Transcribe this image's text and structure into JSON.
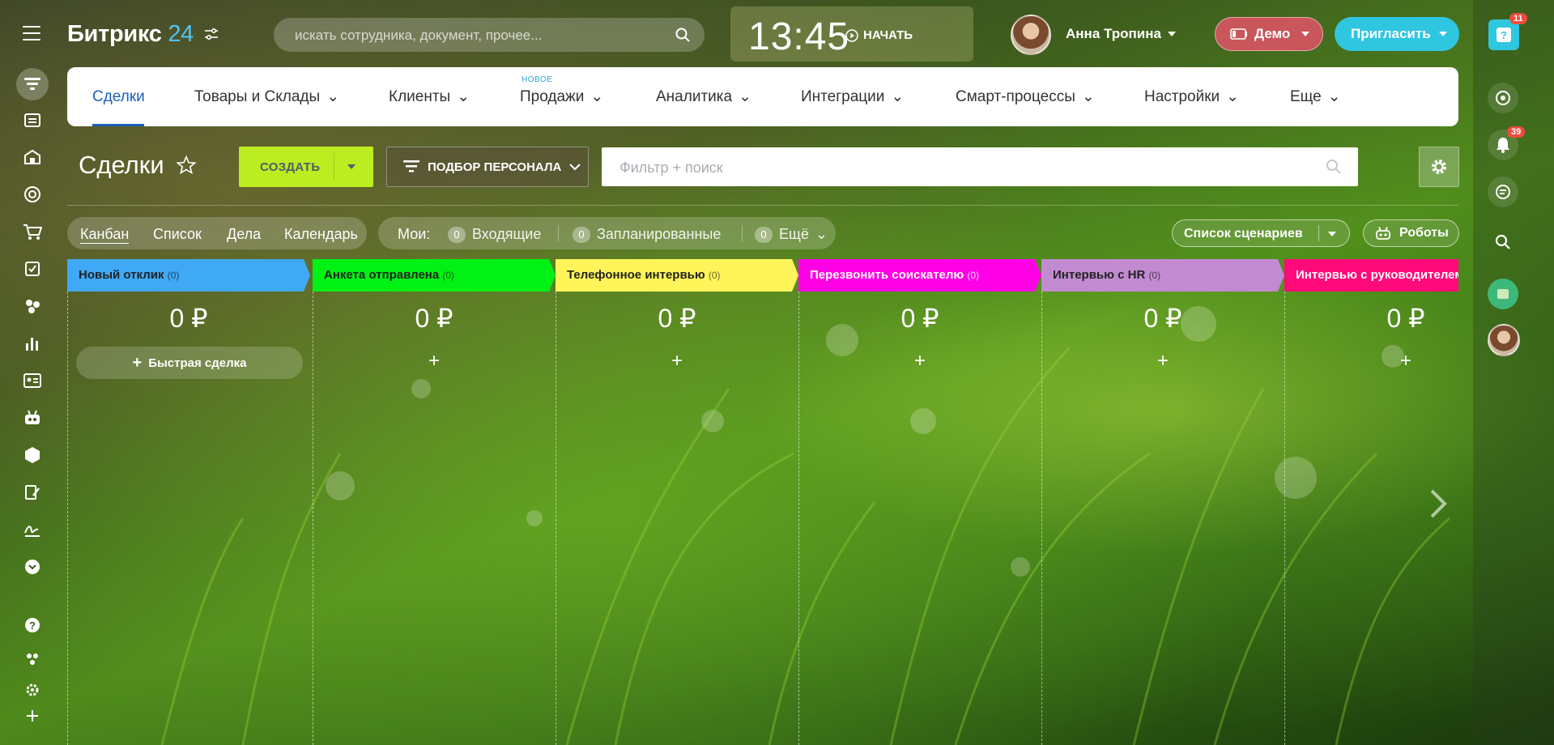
{
  "app": {
    "logo": {
      "name": "Битрикс",
      "num": "24"
    },
    "search_placeholder": "искать сотрудника, документ, прочее...",
    "clock": {
      "time": "13:45",
      "start_label": "НАЧАТЬ"
    },
    "user_name": "Анна Тропина",
    "demo_label": "Демо",
    "invite_label": "Пригласить",
    "help_badge": "11",
    "notifications_badge": "39"
  },
  "nav": {
    "new_label": "НОВОЕ",
    "tabs": [
      {
        "label": "Сделки"
      },
      {
        "label": "Товары и Склады"
      },
      {
        "label": "Клиенты"
      },
      {
        "label": "Продажи"
      },
      {
        "label": "Аналитика"
      },
      {
        "label": "Интеграции"
      },
      {
        "label": "Смарт-процессы"
      },
      {
        "label": "Настройки"
      },
      {
        "label": "Еще"
      }
    ]
  },
  "toolbar": {
    "title": "Сделки",
    "create_label": "СОЗДАТЬ",
    "pipeline_label": "ПОДБОР ПЕРСОНАЛА",
    "filter_placeholder": "Фильтр + поиск"
  },
  "views": {
    "items": [
      "Канбан",
      "Список",
      "Дела",
      "Календарь"
    ],
    "my_label": "Мои:",
    "counters": [
      {
        "count": "0",
        "label": "Входящие"
      },
      {
        "count": "0",
        "label": "Запланированные"
      },
      {
        "count": "0",
        "label": "Ещё"
      }
    ],
    "scenarios_label": "Список сценариев",
    "robots_label": "Роботы"
  },
  "kanban": {
    "quick_deal_label": "Быстрая сделка",
    "columns": [
      {
        "title": "Новый отклик",
        "count": "(0)",
        "sum": "0 ₽",
        "color": "#3fa9f5"
      },
      {
        "title": "Анкета отправлена",
        "count": "(0)",
        "sum": "0 ₽",
        "color": "#00f214"
      },
      {
        "title": "Телефонное интервью",
        "count": "(0)",
        "sum": "0 ₽",
        "color": "#fff55a"
      },
      {
        "title": "Перезвонить соискателю",
        "count": "(0)",
        "sum": "0 ₽",
        "color": "#ff00e6"
      },
      {
        "title": "Интервью с HR",
        "count": "(0)",
        "sum": "0 ₽",
        "color": "#c28ad1"
      },
      {
        "title": "Интервью с руководителем",
        "count": "",
        "sum": "0 ₽",
        "color": "#ff0a7a"
      }
    ]
  }
}
